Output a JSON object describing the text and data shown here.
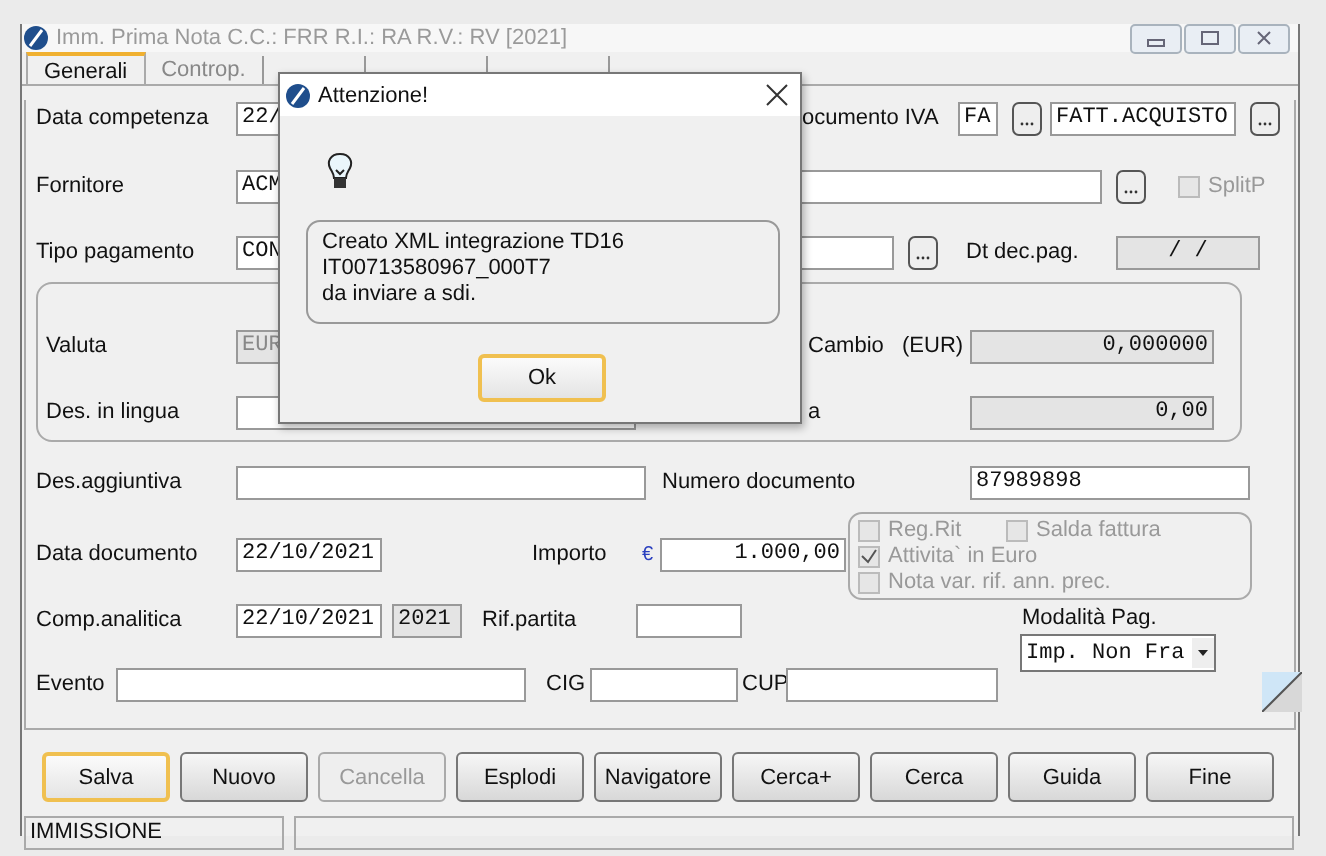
{
  "window": {
    "title": "Imm. Prima Nota C.C.: FRR  R.I.: RA  R.V.: RV  [2021]"
  },
  "tabs": [
    {
      "label": "Generali",
      "selected": true
    },
    {
      "label": "Controp.",
      "selected": false
    }
  ],
  "data_competenza": {
    "label": "Data competenza",
    "value": "22/"
  },
  "documento_iva": {
    "label": "ocumento IVA",
    "code": "FA",
    "description": "FATT.ACQUISTO"
  },
  "fornitore": {
    "label": "Fornitore",
    "value": "ACM"
  },
  "split_p": {
    "label": "SplitP",
    "checked": false,
    "disabled": true
  },
  "tipo_pagamento": {
    "label": "Tipo pagamento",
    "value": "CON"
  },
  "dt_dec_pag": {
    "label": "Dt dec.pag.",
    "value": "/  /"
  },
  "valuta": {
    "label": "Valuta",
    "value": "EUR",
    "disabled": true
  },
  "cambio": {
    "label": "Cambio",
    "currency": "(EUR)",
    "value": "0,000000"
  },
  "des_in_lingua": {
    "label": "Des. in lingua"
  },
  "importo_valuta": {
    "label": "a",
    "value": "0,00"
  },
  "des_aggiuntiva": {
    "label": "Des.aggiuntiva"
  },
  "numero_documento": {
    "label": "Numero documento",
    "value": "87989898"
  },
  "data_documento": {
    "label": "Data documento",
    "value": "22/10/2021"
  },
  "importo": {
    "label": "Importo",
    "symbol": "€",
    "value": "1.000,00"
  },
  "options": [
    {
      "label": "Reg.Rit",
      "checked": false,
      "disabled": true
    },
    {
      "label": "Salda fattura",
      "checked": false,
      "disabled": true
    },
    {
      "label": "Attivita` in Euro",
      "checked": true,
      "disabled": true
    },
    {
      "label": "Nota var. rif. ann. prec.",
      "checked": false,
      "disabled": true
    }
  ],
  "comp_analitica": {
    "label": "Comp.analitica",
    "value": "22/10/2021",
    "year": "2021"
  },
  "rif_partita": {
    "label": "Rif.partita"
  },
  "modalita_pag": {
    "label": "Modalità Pag.",
    "value": "Imp. Non Fra"
  },
  "evento": {
    "label": "Evento"
  },
  "cig": {
    "label": "CIG"
  },
  "cup": {
    "label": "CUP"
  },
  "buttons": [
    {
      "label": "Salva",
      "focused": true,
      "disabled": false
    },
    {
      "label": "Nuovo",
      "focused": false,
      "disabled": false
    },
    {
      "label": "Cancella",
      "focused": false,
      "disabled": true
    },
    {
      "label": "Esplodi",
      "focused": false,
      "disabled": false
    },
    {
      "label": "Navigatore",
      "focused": false,
      "disabled": false
    },
    {
      "label": "Cerca+",
      "focused": false,
      "disabled": false
    },
    {
      "label": "Cerca",
      "focused": false,
      "disabled": false
    },
    {
      "label": "Guida",
      "focused": false,
      "disabled": false
    },
    {
      "label": "Fine",
      "focused": false,
      "disabled": false
    }
  ],
  "status_bar": {
    "mode": "IMMISSIONE"
  },
  "dialog": {
    "title": "Attenzione!",
    "lines": [
      "Creato XML integrazione TD16",
      "IT00713580967_000T7",
      "da inviare a sdi."
    ],
    "button": {
      "label": "Ok",
      "focused": true
    }
  }
}
